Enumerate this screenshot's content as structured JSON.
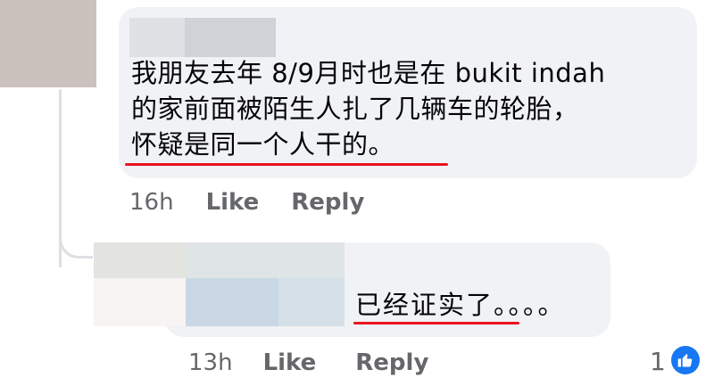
{
  "comment": {
    "lines": [
      "我朋友去年 8/9月时也是在 bukit indah",
      "的家前面被陌生人扎了几辆车的轮胎，",
      "怀疑是同一个人干的。"
    ],
    "time": "16h",
    "like_label": "Like",
    "reply_label": "Reply"
  },
  "reply": {
    "text": "已经证实了。。。。",
    "time": "13h",
    "like_label": "Like",
    "reply_label": "Reply",
    "reaction_count": "1",
    "reaction_icon": "like-icon"
  },
  "colors": {
    "bubble": "#f0f2f5",
    "underline": "#e8141c",
    "meta_text": "#65676b",
    "like_badge": "#1877f2"
  }
}
